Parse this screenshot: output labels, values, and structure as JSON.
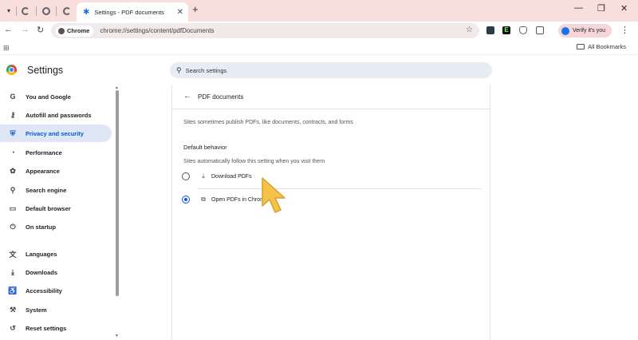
{
  "browser": {
    "active_tab_title": "Settings - PDF documents",
    "omnibox_chip": "Chrome",
    "url": "chrome://settings/content/pdfDocuments",
    "profile_button": "Verify it's you",
    "all_bookmarks": "All Bookmarks"
  },
  "settings": {
    "title": "Settings",
    "search_placeholder": "Search settings"
  },
  "sidebar": {
    "items": [
      {
        "label": "You and Google",
        "icon": "google-icon"
      },
      {
        "label": "Autofill and passwords",
        "icon": "key-icon"
      },
      {
        "label": "Privacy and security",
        "icon": "shield-icon"
      },
      {
        "label": "Performance",
        "icon": "speedometer-icon"
      },
      {
        "label": "Appearance",
        "icon": "palette-icon"
      },
      {
        "label": "Search engine",
        "icon": "search-icon"
      },
      {
        "label": "Default browser",
        "icon": "browser-icon"
      },
      {
        "label": "On startup",
        "icon": "power-icon"
      },
      {
        "label": "Languages",
        "icon": "translate-icon"
      },
      {
        "label": "Downloads",
        "icon": "download-icon"
      },
      {
        "label": "Accessibility",
        "icon": "accessibility-icon"
      },
      {
        "label": "System",
        "icon": "wrench-icon"
      },
      {
        "label": "Reset settings",
        "icon": "reset-icon"
      }
    ],
    "active_index": 2
  },
  "page": {
    "title": "PDF documents",
    "description": "Sites sometimes publish PDFs, like documents, contracts, and forms",
    "default_behavior_heading": "Default behavior",
    "default_behavior_sub": "Sites automatically follow this setting when you visit them",
    "options": [
      {
        "label": "Download PDFs",
        "selected": false,
        "icon": "download-icon"
      },
      {
        "label": "Open PDFs in Chrome",
        "selected": true,
        "icon": "open-in-browser-icon"
      }
    ]
  },
  "colors": {
    "accent": "#0b57d0",
    "tabstrip": "#f9dede",
    "active_nav_bg": "#dfe6f6",
    "cursor": "#f5c24a"
  }
}
